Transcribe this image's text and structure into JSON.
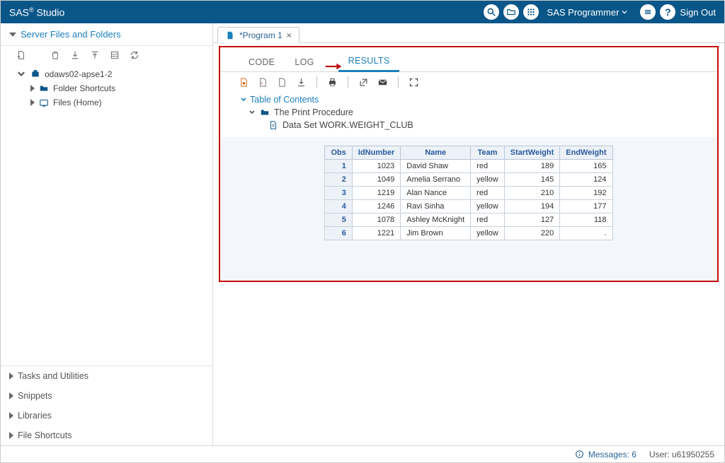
{
  "brand": {
    "prefix": "SAS",
    "suffix": " Studio"
  },
  "topbar": {
    "user_label": "SAS Programmer",
    "signout": "Sign Out"
  },
  "sidebar": {
    "panel_title": "Server Files and Folders",
    "root_label": "odaws02-apse1-2",
    "folder_shortcuts": "Folder Shortcuts",
    "files_home": "Files (Home)",
    "collapsed": [
      "Tasks and Utilities",
      "Snippets",
      "Libraries",
      "File Shortcuts"
    ]
  },
  "tabs": {
    "program1": "*Program 1"
  },
  "subtabs": {
    "code": "CODE",
    "log": "LOG",
    "results": "RESULTS"
  },
  "toc": {
    "header": "Table of Contents",
    "proc": "The Print Procedure",
    "dataset": "Data Set WORK.WEIGHT_CLUB"
  },
  "table": {
    "headers": [
      "Obs",
      "IdNumber",
      "Name",
      "Team",
      "StartWeight",
      "EndWeight"
    ],
    "rows": [
      {
        "obs": 1,
        "id": 1023,
        "name": "David Shaw",
        "team": "red",
        "start": 189,
        "end": 165
      },
      {
        "obs": 2,
        "id": 1049,
        "name": "Amelia Serrano",
        "team": "yellow",
        "start": 145,
        "end": 124
      },
      {
        "obs": 3,
        "id": 1219,
        "name": "Alan Nance",
        "team": "red",
        "start": 210,
        "end": 192
      },
      {
        "obs": 4,
        "id": 1246,
        "name": "Ravi Sinha",
        "team": "yellow",
        "start": 194,
        "end": 177
      },
      {
        "obs": 5,
        "id": 1078,
        "name": "Ashley McKnight",
        "team": "red",
        "start": 127,
        "end": 118
      },
      {
        "obs": 6,
        "id": 1221,
        "name": "Jim Brown",
        "team": "yellow",
        "start": 220,
        "end": "."
      }
    ]
  },
  "status": {
    "messages_label": "Messages: 6",
    "user_label": "User: u61950255"
  }
}
